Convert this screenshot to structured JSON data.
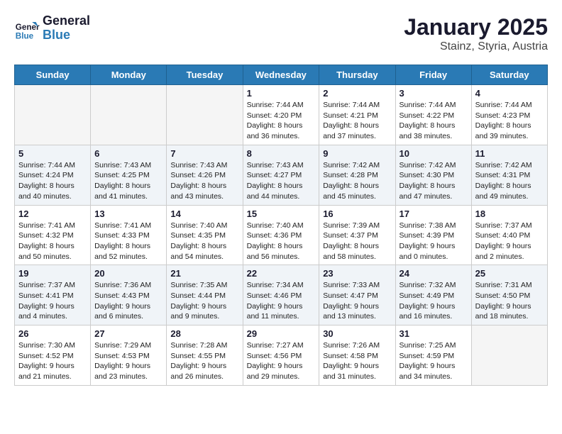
{
  "header": {
    "logo_line1": "General",
    "logo_line2": "Blue",
    "month": "January 2025",
    "location": "Stainz, Styria, Austria"
  },
  "weekdays": [
    "Sunday",
    "Monday",
    "Tuesday",
    "Wednesday",
    "Thursday",
    "Friday",
    "Saturday"
  ],
  "weeks": [
    [
      {
        "day": "",
        "info": ""
      },
      {
        "day": "",
        "info": ""
      },
      {
        "day": "",
        "info": ""
      },
      {
        "day": "1",
        "info": "Sunrise: 7:44 AM\nSunset: 4:20 PM\nDaylight: 8 hours and 36 minutes."
      },
      {
        "day": "2",
        "info": "Sunrise: 7:44 AM\nSunset: 4:21 PM\nDaylight: 8 hours and 37 minutes."
      },
      {
        "day": "3",
        "info": "Sunrise: 7:44 AM\nSunset: 4:22 PM\nDaylight: 8 hours and 38 minutes."
      },
      {
        "day": "4",
        "info": "Sunrise: 7:44 AM\nSunset: 4:23 PM\nDaylight: 8 hours and 39 minutes."
      }
    ],
    [
      {
        "day": "5",
        "info": "Sunrise: 7:44 AM\nSunset: 4:24 PM\nDaylight: 8 hours and 40 minutes."
      },
      {
        "day": "6",
        "info": "Sunrise: 7:43 AM\nSunset: 4:25 PM\nDaylight: 8 hours and 41 minutes."
      },
      {
        "day": "7",
        "info": "Sunrise: 7:43 AM\nSunset: 4:26 PM\nDaylight: 8 hours and 43 minutes."
      },
      {
        "day": "8",
        "info": "Sunrise: 7:43 AM\nSunset: 4:27 PM\nDaylight: 8 hours and 44 minutes."
      },
      {
        "day": "9",
        "info": "Sunrise: 7:42 AM\nSunset: 4:28 PM\nDaylight: 8 hours and 45 minutes."
      },
      {
        "day": "10",
        "info": "Sunrise: 7:42 AM\nSunset: 4:30 PM\nDaylight: 8 hours and 47 minutes."
      },
      {
        "day": "11",
        "info": "Sunrise: 7:42 AM\nSunset: 4:31 PM\nDaylight: 8 hours and 49 minutes."
      }
    ],
    [
      {
        "day": "12",
        "info": "Sunrise: 7:41 AM\nSunset: 4:32 PM\nDaylight: 8 hours and 50 minutes."
      },
      {
        "day": "13",
        "info": "Sunrise: 7:41 AM\nSunset: 4:33 PM\nDaylight: 8 hours and 52 minutes."
      },
      {
        "day": "14",
        "info": "Sunrise: 7:40 AM\nSunset: 4:35 PM\nDaylight: 8 hours and 54 minutes."
      },
      {
        "day": "15",
        "info": "Sunrise: 7:40 AM\nSunset: 4:36 PM\nDaylight: 8 hours and 56 minutes."
      },
      {
        "day": "16",
        "info": "Sunrise: 7:39 AM\nSunset: 4:37 PM\nDaylight: 8 hours and 58 minutes."
      },
      {
        "day": "17",
        "info": "Sunrise: 7:38 AM\nSunset: 4:39 PM\nDaylight: 9 hours and 0 minutes."
      },
      {
        "day": "18",
        "info": "Sunrise: 7:37 AM\nSunset: 4:40 PM\nDaylight: 9 hours and 2 minutes."
      }
    ],
    [
      {
        "day": "19",
        "info": "Sunrise: 7:37 AM\nSunset: 4:41 PM\nDaylight: 9 hours and 4 minutes."
      },
      {
        "day": "20",
        "info": "Sunrise: 7:36 AM\nSunset: 4:43 PM\nDaylight: 9 hours and 6 minutes."
      },
      {
        "day": "21",
        "info": "Sunrise: 7:35 AM\nSunset: 4:44 PM\nDaylight: 9 hours and 9 minutes."
      },
      {
        "day": "22",
        "info": "Sunrise: 7:34 AM\nSunset: 4:46 PM\nDaylight: 9 hours and 11 minutes."
      },
      {
        "day": "23",
        "info": "Sunrise: 7:33 AM\nSunset: 4:47 PM\nDaylight: 9 hours and 13 minutes."
      },
      {
        "day": "24",
        "info": "Sunrise: 7:32 AM\nSunset: 4:49 PM\nDaylight: 9 hours and 16 minutes."
      },
      {
        "day": "25",
        "info": "Sunrise: 7:31 AM\nSunset: 4:50 PM\nDaylight: 9 hours and 18 minutes."
      }
    ],
    [
      {
        "day": "26",
        "info": "Sunrise: 7:30 AM\nSunset: 4:52 PM\nDaylight: 9 hours and 21 minutes."
      },
      {
        "day": "27",
        "info": "Sunrise: 7:29 AM\nSunset: 4:53 PM\nDaylight: 9 hours and 23 minutes."
      },
      {
        "day": "28",
        "info": "Sunrise: 7:28 AM\nSunset: 4:55 PM\nDaylight: 9 hours and 26 minutes."
      },
      {
        "day": "29",
        "info": "Sunrise: 7:27 AM\nSunset: 4:56 PM\nDaylight: 9 hours and 29 minutes."
      },
      {
        "day": "30",
        "info": "Sunrise: 7:26 AM\nSunset: 4:58 PM\nDaylight: 9 hours and 31 minutes."
      },
      {
        "day": "31",
        "info": "Sunrise: 7:25 AM\nSunset: 4:59 PM\nDaylight: 9 hours and 34 minutes."
      },
      {
        "day": "",
        "info": ""
      }
    ]
  ]
}
